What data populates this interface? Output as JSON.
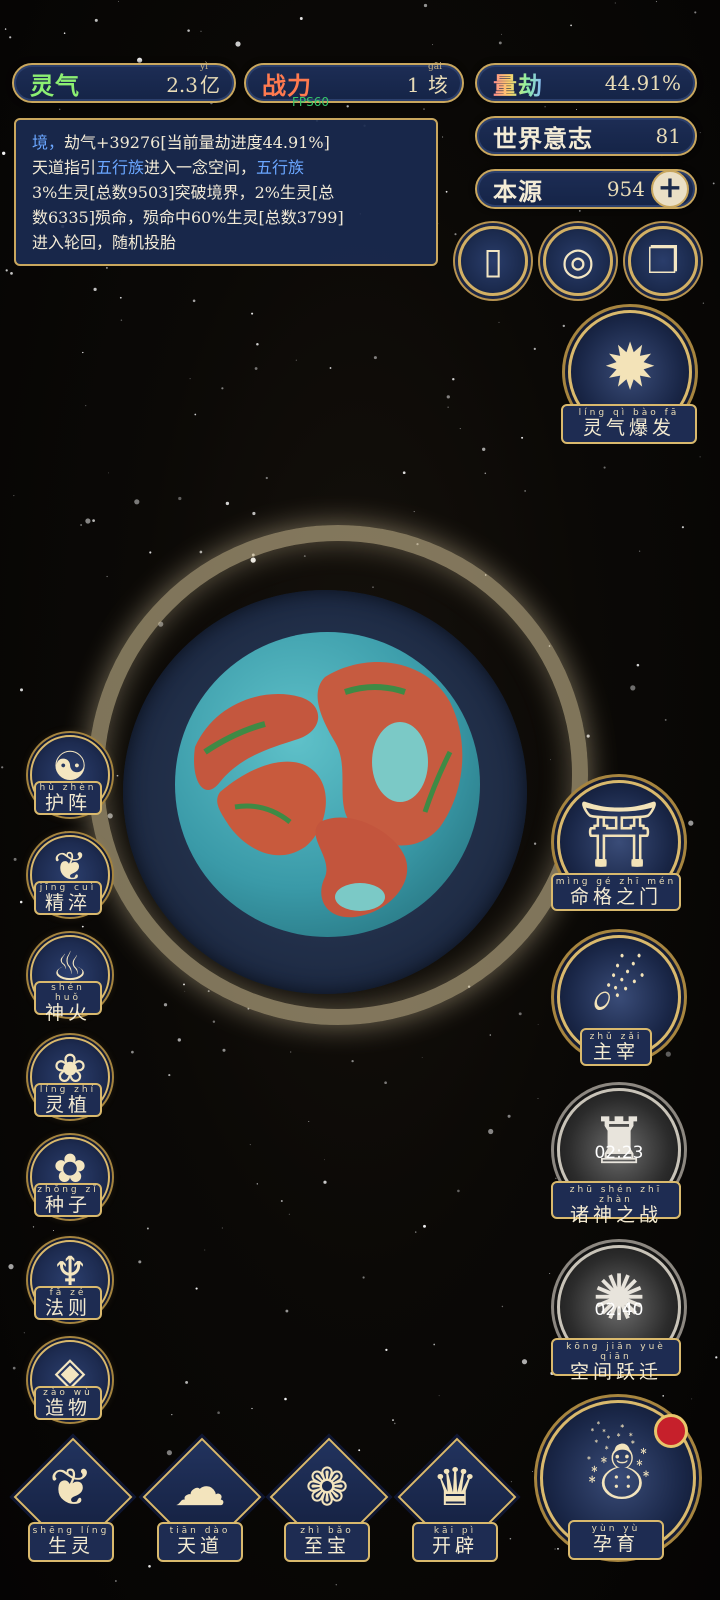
{
  "stats": {
    "lingqi": {
      "label": "灵气",
      "value": "2.3",
      "unit": "亿",
      "unit_pinyin": "yì"
    },
    "zhanli": {
      "label": "战力",
      "value": "1",
      "unit": "垓",
      "unit_pinyin": "gāi"
    },
    "liangjie": {
      "label": "量劫",
      "value": "44.91%"
    },
    "shijie_yizhi": {
      "label": "世界意志",
      "value": "81"
    },
    "benyuan": {
      "label": "本源",
      "value": "954",
      "plus": "+"
    }
  },
  "fps": "FPS60",
  "log": {
    "lines": [
      [
        {
          "t": "境，",
          "hl": true
        },
        {
          "t": "劫气+39276[当前量劫进度44.91%]"
        }
      ],
      [
        {
          "t": "天道指引"
        },
        {
          "t": "五行族",
          "hl": true
        },
        {
          "t": "进入一念空间，"
        },
        {
          "t": "五行族",
          "hl": true
        }
      ],
      [
        {
          "t": "3%生灵[总数9503]突破境界，2%生灵[总"
        }
      ],
      [
        {
          "t": "数6335]殒命，殒命中60%生灵[总数3799]"
        }
      ],
      [
        {
          "t": "进入轮回，随机投胎"
        }
      ]
    ]
  },
  "top_buttons": [
    {
      "name": "card-icon",
      "glyph": "▯"
    },
    {
      "name": "vortex-icon",
      "glyph": "◎"
    },
    {
      "name": "scroll-icon",
      "glyph": "❐"
    }
  ],
  "lingqi_baofa": {
    "label": "灵气爆发",
    "pinyin": "líng qì bào fā"
  },
  "left_skills": [
    {
      "id": "huzhen",
      "label": "护阵",
      "pinyin": "hù zhèn",
      "glyph": "☯"
    },
    {
      "id": "jingcui",
      "label": "精淬",
      "pinyin": "jīng cuì",
      "glyph": "❦"
    },
    {
      "id": "shenhuo",
      "label": "神火",
      "pinyin": "shén huǒ",
      "glyph": "♨"
    },
    {
      "id": "lingzhi",
      "label": "灵植",
      "pinyin": "líng zhí",
      "glyph": "❀"
    },
    {
      "id": "zhongzi",
      "label": "种子",
      "pinyin": "zhǒng zǐ",
      "glyph": "✿"
    },
    {
      "id": "faze",
      "label": "法则",
      "pinyin": "fǎ zé",
      "glyph": "♆"
    },
    {
      "id": "zaowu",
      "label": "造物",
      "pinyin": "zào wù",
      "glyph": "◈"
    }
  ],
  "right_skills": [
    {
      "id": "mingge",
      "label": "命格之门",
      "pinyin": "mìng gé zhī mén",
      "glyph": "⛩",
      "gray": false,
      "timer": ""
    },
    {
      "id": "zhuzai",
      "label": "主宰",
      "pinyin": "zhǔ zǎi",
      "glyph": "☄",
      "gray": false,
      "timer": ""
    },
    {
      "id": "zhushen",
      "label": "诸神之战",
      "pinyin": "zhū shén zhī zhàn",
      "glyph": "♜",
      "gray": true,
      "timer": "02:23"
    },
    {
      "id": "kongjian",
      "label": "空间跃迁",
      "pinyin": "kōng jiān yuè qiān",
      "glyph": "✺",
      "gray": true,
      "timer": "02:40"
    }
  ],
  "bottom_nav": [
    {
      "id": "shengling",
      "label": "生灵",
      "pinyin": "shēng líng",
      "glyph": "❦"
    },
    {
      "id": "tiandao",
      "label": "天道",
      "pinyin": "tiān dào",
      "glyph": "☁"
    },
    {
      "id": "zhibao",
      "label": "至宝",
      "pinyin": "zhì bǎo",
      "glyph": "❁"
    },
    {
      "id": "kaipi",
      "label": "开辟",
      "pinyin": "kāi pì",
      "glyph": "♛"
    }
  ],
  "yunyu": {
    "label": "孕育",
    "pinyin": "yùn yù",
    "glyph": "☃"
  },
  "colors": {
    "gold": "#d9b96d",
    "panel": "#1d2d55",
    "highlight": "#6aa6ff",
    "planet_sea": "#3a9aa8",
    "planet_land": "#c4573e"
  }
}
